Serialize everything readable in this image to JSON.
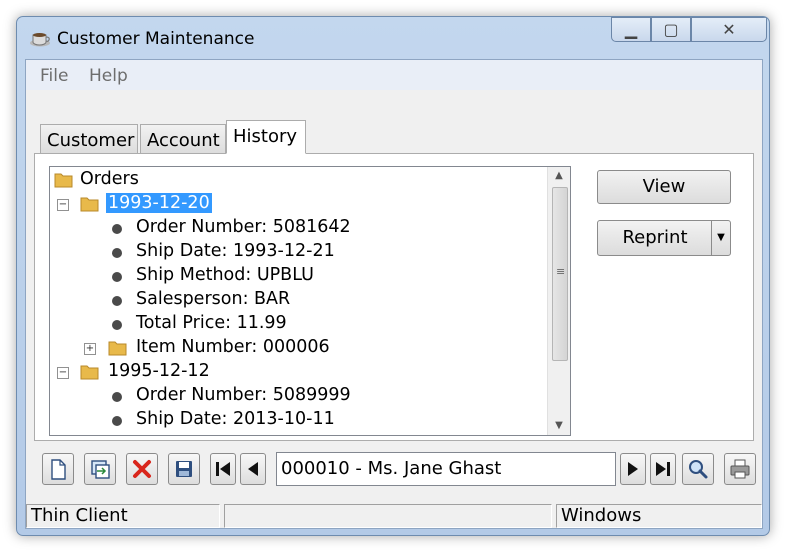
{
  "window": {
    "title": "Customer Maintenance"
  },
  "menu": {
    "items": [
      "File",
      "Help"
    ]
  },
  "tabs": [
    {
      "label": "Customer"
    },
    {
      "label": "Account"
    },
    {
      "label": "History"
    }
  ],
  "active_tab": "History",
  "tree": {
    "root": "Orders",
    "nodes": [
      {
        "label": "1993-12-20",
        "type": "folder",
        "expander": "minus",
        "selected": true
      },
      {
        "label": "Order Number: 5081642",
        "type": "leaf"
      },
      {
        "label": "Ship Date: 1993-12-21",
        "type": "leaf"
      },
      {
        "label": "Ship Method: UPBLU",
        "type": "leaf"
      },
      {
        "label": "Salesperson: BAR",
        "type": "leaf"
      },
      {
        "label": "Total Price: 11.99",
        "type": "leaf"
      },
      {
        "label": "Item Number: 000006",
        "type": "folder",
        "expander": "plus"
      },
      {
        "label": "1995-12-12",
        "type": "folder",
        "expander": "minus"
      },
      {
        "label": "Order Number: 5089999",
        "type": "leaf"
      },
      {
        "label": "Ship Date: 2013-10-11",
        "type": "leaf"
      }
    ]
  },
  "buttons": {
    "view": "View",
    "reprint": "Reprint"
  },
  "navigator": {
    "current_record": "000010 - Ms. Jane Ghast"
  },
  "statusbar": {
    "left": "Thin Client",
    "middle": "",
    "right": "Windows"
  },
  "colors": {
    "selection": "#3399ff",
    "delete_icon": "#d9261c",
    "folder": "#e8b94a"
  }
}
